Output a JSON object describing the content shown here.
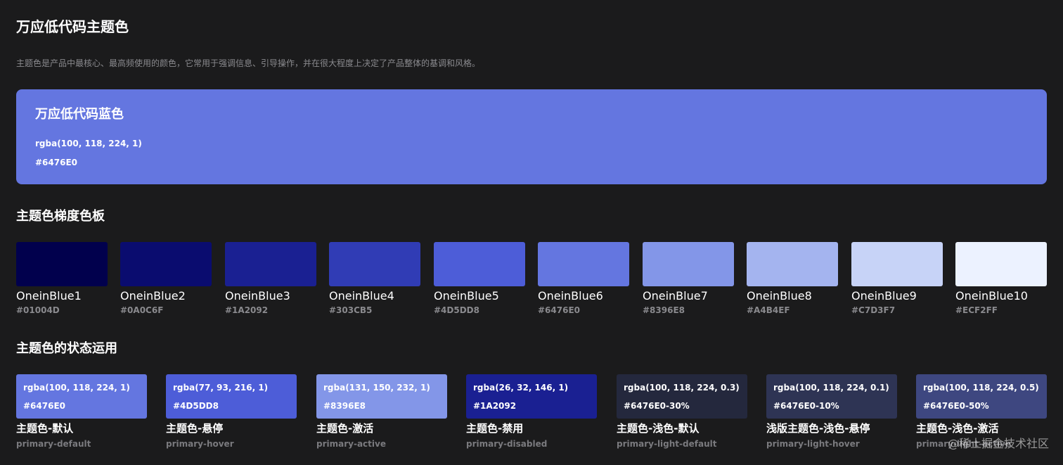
{
  "page": {
    "title": "万应低代码主题色",
    "description": "主题色是产品中最核心、最高频使用的颜色，它常用于强调信息、引导操作，并在很大程度上决定了产品整体的基调和风格。"
  },
  "hero": {
    "title": "万应低代码蓝色",
    "rgba": "rgba(100, 118, 224, 1)",
    "hex": "#6476E0",
    "color": "#6476E0"
  },
  "palette": {
    "title": "主题色梯度色板",
    "items": [
      {
        "name": "OneinBlue1",
        "hex": "#01004D",
        "color": "#01004D"
      },
      {
        "name": "OneinBlue2",
        "hex": "#0A0C6F",
        "color": "#0A0C6F"
      },
      {
        "name": "OneinBlue3",
        "hex": "#1A2092",
        "color": "#1A2092"
      },
      {
        "name": "OneinBlue4",
        "hex": "#303CB5",
        "color": "#303CB5"
      },
      {
        "name": "OneinBlue5",
        "hex": "#4D5DD8",
        "color": "#4D5DD8"
      },
      {
        "name": "OneinBlue6",
        "hex": "#6476E0",
        "color": "#6476E0"
      },
      {
        "name": "OneinBlue7",
        "hex": "#8396E8",
        "color": "#8396E8"
      },
      {
        "name": "OneinBlue8",
        "hex": "#A4B4EF",
        "color": "#A4B4EF"
      },
      {
        "name": "OneinBlue9",
        "hex": "#C7D3F7",
        "color": "#C7D3F7"
      },
      {
        "name": "OneinBlue10",
        "hex": "#ECF2FF",
        "color": "#ECF2FF"
      }
    ]
  },
  "states": {
    "title": "主题色的状态运用",
    "items": [
      {
        "rgba": "rgba(100, 118, 224, 1)",
        "hex": "#6476E0",
        "name": "主题色-默认",
        "key": "primary-default",
        "color": "#6476E0"
      },
      {
        "rgba": "rgba(77, 93, 216, 1)",
        "hex": "#4D5DD8",
        "name": "主题色-悬停",
        "key": "primary-hover",
        "color": "#4D5DD8"
      },
      {
        "rgba": "rgba(131, 150, 232, 1)",
        "hex": "#8396E8",
        "name": "主题色-激活",
        "key": "primary-active",
        "color": "#8396E8"
      },
      {
        "rgba": "rgba(26, 32, 146, 1)",
        "hex": "#1A2092",
        "name": "主题色-禁用",
        "key": "primary-disabled",
        "color": "#1A2092"
      },
      {
        "rgba": "rgba(100, 118, 224, 0.3)",
        "hex": "#6476E0-30%",
        "name": "主题色-浅色-默认",
        "key": "primary-light-default",
        "color": "#24283d"
      },
      {
        "rgba": "rgba(100, 118, 224, 0.1)",
        "hex": "#6476E0-10%",
        "name": "浅版主题色-浅色-悬停",
        "key": "primary-light-hover",
        "color": "#2e3454"
      },
      {
        "rgba": "rgba(100, 118, 224, 0.5)",
        "hex": "#6476E0-50%",
        "name": "主题色-浅色-激活",
        "key": "primary-light-active",
        "color": "#3e4780"
      }
    ]
  },
  "watermark": "@稀土掘金技术社区"
}
